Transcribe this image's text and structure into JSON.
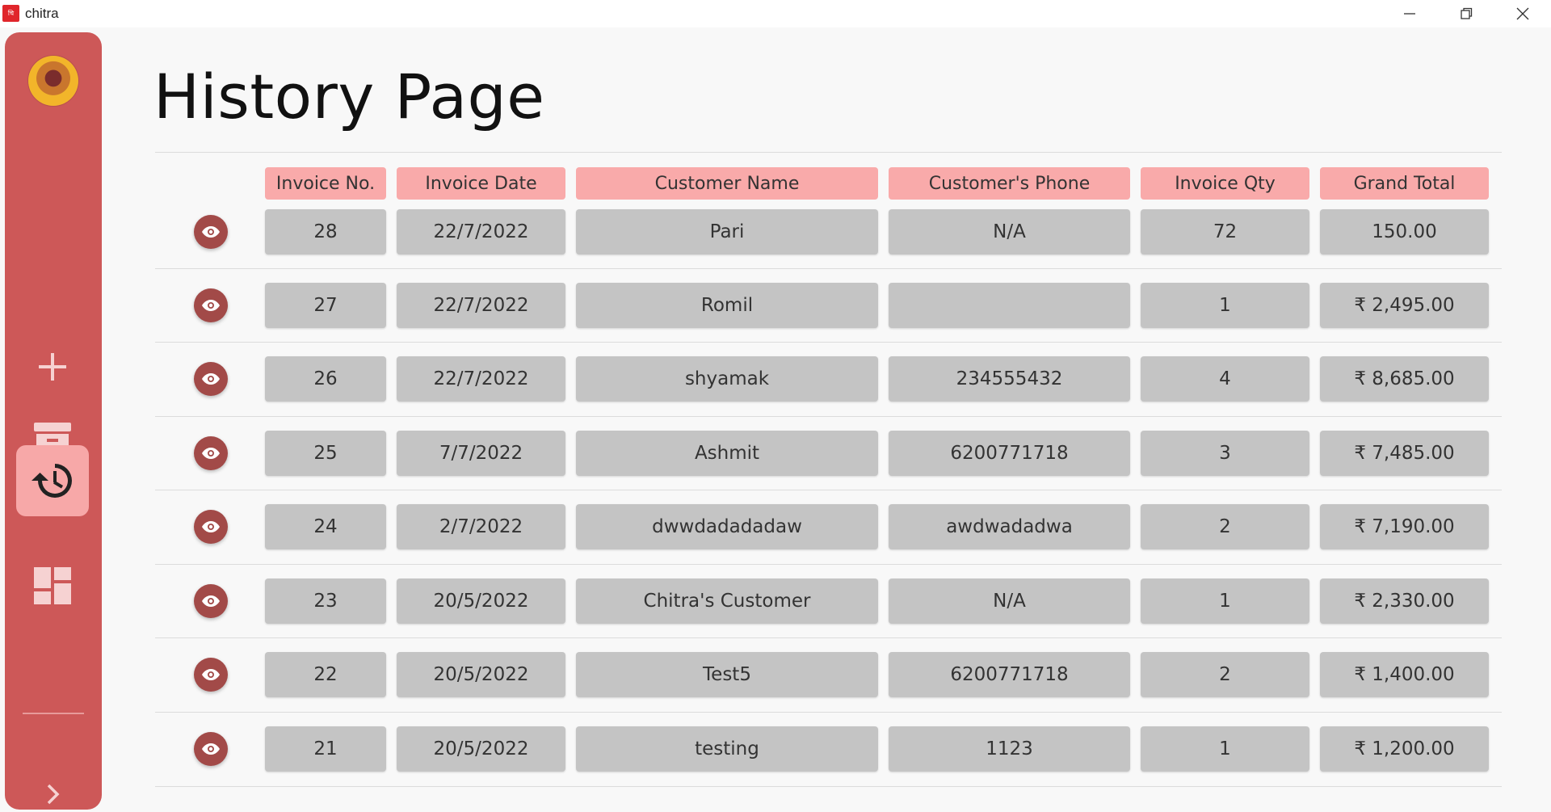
{
  "window": {
    "title": "chitra",
    "icon_text": "चि"
  },
  "sidebar": {
    "avatar": "deity-avatar",
    "items": [
      {
        "name": "add-invoice",
        "icon": "plus-icon"
      },
      {
        "name": "inventory",
        "icon": "archive-icon"
      },
      {
        "name": "history",
        "icon": "history-icon",
        "active": true
      },
      {
        "name": "dashboard",
        "icon": "dashboard-icon"
      }
    ],
    "expand_icon": "chevron-right-icon"
  },
  "page": {
    "title": "History Page"
  },
  "table": {
    "headers": [
      "Invoice No.",
      "Invoice Date",
      "Customer Name",
      "Customer's Phone",
      "Invoice Qty",
      "Grand Total"
    ],
    "rows": [
      {
        "no": "28",
        "date": "22/7/2022",
        "name": "Pari",
        "phone": "N/A",
        "qty": "72",
        "total": "150.00"
      },
      {
        "no": "27",
        "date": "22/7/2022",
        "name": "Romil",
        "phone": "",
        "qty": "1",
        "total": "₹ 2,495.00"
      },
      {
        "no": "26",
        "date": "22/7/2022",
        "name": "shyamak",
        "phone": "234555432",
        "qty": "4",
        "total": "₹ 8,685.00"
      },
      {
        "no": "25",
        "date": "7/7/2022",
        "name": "Ashmit",
        "phone": "6200771718",
        "qty": "3",
        "total": "₹ 7,485.00"
      },
      {
        "no": "24",
        "date": "2/7/2022",
        "name": "dwwdadadadaw",
        "phone": "awdwadadwa",
        "qty": "2",
        "total": "₹ 7,190.00"
      },
      {
        "no": "23",
        "date": "20/5/2022",
        "name": "Chitra's Customer",
        "phone": "N/A",
        "qty": "1",
        "total": "₹ 2,330.00"
      },
      {
        "no": "22",
        "date": "20/5/2022",
        "name": "Test5",
        "phone": "6200771718",
        "qty": "2",
        "total": "₹ 1,400.00"
      },
      {
        "no": "21",
        "date": "20/5/2022",
        "name": "testing",
        "phone": "1123",
        "qty": "1",
        "total": "₹ 1,200.00"
      }
    ]
  },
  "colors": {
    "sidebar": "#cd5858",
    "active_nav": "#f7a8a8",
    "header_cell": "#f9aaaa",
    "data_cell": "#c4c4c4",
    "eye_button": "#a24a48"
  }
}
